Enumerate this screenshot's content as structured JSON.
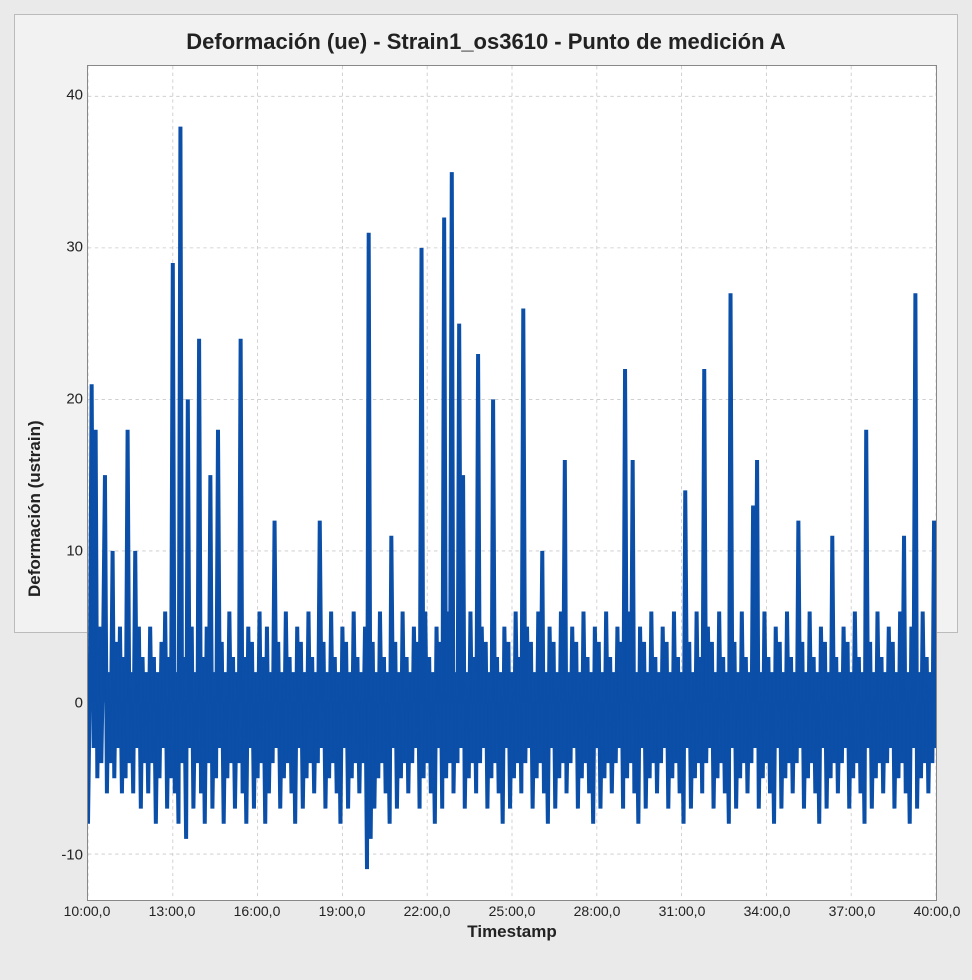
{
  "chart_data": {
    "type": "line",
    "title": "Deformación (ue) - Strain1_os3610 - Punto de medición A",
    "xlabel": "Timestamp",
    "ylabel": "Deformación (ustrain)",
    "ylim": [
      -13,
      42
    ],
    "xlim": [
      10,
      40
    ],
    "xticks": [
      "10:00,0",
      "13:00,0",
      "16:00,0",
      "19:00,0",
      "22:00,0",
      "25:00,0",
      "28:00,0",
      "31:00,0",
      "34:00,0",
      "37:00,0",
      "40:00,0"
    ],
    "yticks": [
      -10,
      0,
      10,
      20,
      30,
      40
    ],
    "color": "#0b4fa8",
    "note": "Dense noisy strain time-series; values approximate — read from pixel geometry",
    "series": [
      {
        "name": "Strain1_os3610",
        "x": [
          10.0,
          10.07,
          10.13,
          10.2,
          10.27,
          10.33,
          10.4,
          10.47,
          10.53,
          10.6,
          10.67,
          10.73,
          10.8,
          10.87,
          10.93,
          11.0,
          11.07,
          11.13,
          11.2,
          11.27,
          11.33,
          11.4,
          11.47,
          11.53,
          11.6,
          11.67,
          11.73,
          11.8,
          11.87,
          11.93,
          12.0,
          12.07,
          12.13,
          12.2,
          12.27,
          12.33,
          12.4,
          12.47,
          12.53,
          12.6,
          12.67,
          12.73,
          12.8,
          12.87,
          12.93,
          13.0,
          13.07,
          13.13,
          13.2,
          13.27,
          13.33,
          13.4,
          13.47,
          13.53,
          13.6,
          13.67,
          13.73,
          13.8,
          13.87,
          13.93,
          14.0,
          14.07,
          14.13,
          14.2,
          14.27,
          14.33,
          14.4,
          14.47,
          14.53,
          14.6,
          14.67,
          14.73,
          14.8,
          14.87,
          14.93,
          15.0,
          15.07,
          15.13,
          15.2,
          15.27,
          15.33,
          15.4,
          15.47,
          15.53,
          15.6,
          15.67,
          15.73,
          15.8,
          15.87,
          15.93,
          16.0,
          16.07,
          16.13,
          16.2,
          16.27,
          16.33,
          16.4,
          16.47,
          16.53,
          16.6,
          16.67,
          16.73,
          16.8,
          16.87,
          16.93,
          17.0,
          17.07,
          17.13,
          17.2,
          17.27,
          17.33,
          17.4,
          17.47,
          17.53,
          17.6,
          17.67,
          17.73,
          17.8,
          17.87,
          17.93,
          18.0,
          18.07,
          18.13,
          18.2,
          18.27,
          18.33,
          18.4,
          18.47,
          18.53,
          18.6,
          18.67,
          18.73,
          18.8,
          18.87,
          18.93,
          19.0,
          19.07,
          19.13,
          19.2,
          19.27,
          19.33,
          19.4,
          19.47,
          19.53,
          19.6,
          19.67,
          19.73,
          19.8,
          19.87,
          19.93,
          20.0,
          20.07,
          20.13,
          20.2,
          20.27,
          20.33,
          20.4,
          20.47,
          20.53,
          20.6,
          20.67,
          20.73,
          20.8,
          20.87,
          20.93,
          21.0,
          21.07,
          21.13,
          21.2,
          21.27,
          21.33,
          21.4,
          21.47,
          21.53,
          21.6,
          21.67,
          21.73,
          21.8,
          21.87,
          21.93,
          22.0,
          22.07,
          22.13,
          22.2,
          22.27,
          22.33,
          22.4,
          22.47,
          22.53,
          22.6,
          22.67,
          22.73,
          22.8,
          22.87,
          22.93,
          23.0,
          23.07,
          23.13,
          23.2,
          23.27,
          23.33,
          23.4,
          23.47,
          23.53,
          23.6,
          23.67,
          23.73,
          23.8,
          23.87,
          23.93,
          24.0,
          24.07,
          24.13,
          24.2,
          24.27,
          24.33,
          24.4,
          24.47,
          24.53,
          24.6,
          24.67,
          24.73,
          24.8,
          24.87,
          24.93,
          25.0,
          25.07,
          25.13,
          25.2,
          25.27,
          25.33,
          25.4,
          25.47,
          25.53,
          25.6,
          25.67,
          25.73,
          25.8,
          25.87,
          25.93,
          26.0,
          26.07,
          26.13,
          26.2,
          26.27,
          26.33,
          26.4,
          26.47,
          26.53,
          26.6,
          26.67,
          26.73,
          26.8,
          26.87,
          26.93,
          27.0,
          27.07,
          27.13,
          27.2,
          27.27,
          27.33,
          27.4,
          27.47,
          27.53,
          27.6,
          27.67,
          27.73,
          27.8,
          27.87,
          27.93,
          28.0,
          28.07,
          28.13,
          28.2,
          28.27,
          28.33,
          28.4,
          28.47,
          28.53,
          28.6,
          28.67,
          28.73,
          28.8,
          28.87,
          28.93,
          29.0,
          29.07,
          29.13,
          29.2,
          29.27,
          29.33,
          29.4,
          29.47,
          29.53,
          29.6,
          29.67,
          29.73,
          29.8,
          29.87,
          29.93,
          30.0,
          30.07,
          30.13,
          30.2,
          30.27,
          30.33,
          30.4,
          30.47,
          30.53,
          30.6,
          30.67,
          30.73,
          30.8,
          30.87,
          30.93,
          31.0,
          31.07,
          31.13,
          31.2,
          31.27,
          31.33,
          31.4,
          31.47,
          31.53,
          31.6,
          31.67,
          31.73,
          31.8,
          31.87,
          31.93,
          32.0,
          32.07,
          32.13,
          32.2,
          32.27,
          32.33,
          32.4,
          32.47,
          32.53,
          32.6,
          32.67,
          32.73,
          32.8,
          32.87,
          32.93,
          33.0,
          33.07,
          33.13,
          33.2,
          33.27,
          33.33,
          33.4,
          33.47,
          33.53,
          33.6,
          33.67,
          33.73,
          33.8,
          33.87,
          33.93,
          34.0,
          34.07,
          34.13,
          34.2,
          34.27,
          34.33,
          34.4,
          34.47,
          34.53,
          34.6,
          34.67,
          34.73,
          34.8,
          34.87,
          34.93,
          35.0,
          35.07,
          35.13,
          35.2,
          35.27,
          35.33,
          35.4,
          35.47,
          35.53,
          35.6,
          35.67,
          35.73,
          35.8,
          35.87,
          35.93,
          36.0,
          36.07,
          36.13,
          36.2,
          36.27,
          36.33,
          36.4,
          36.47,
          36.53,
          36.6,
          36.67,
          36.73,
          36.8,
          36.87,
          36.93,
          37.0,
          37.07,
          37.13,
          37.2,
          37.27,
          37.33,
          37.4,
          37.47,
          37.53,
          37.6,
          37.67,
          37.73,
          37.8,
          37.87,
          37.93,
          38.0,
          38.07,
          38.13,
          38.2,
          38.27,
          38.33,
          38.4,
          38.47,
          38.53,
          38.6,
          38.67,
          38.73,
          38.8,
          38.87,
          38.93,
          39.0,
          39.07,
          39.13,
          39.2,
          39.27,
          39.33,
          39.4,
          39.47,
          39.53,
          39.6,
          39.67,
          39.73,
          39.8,
          39.87,
          39.93,
          40.0
        ],
        "y": [
          -8,
          2,
          21,
          -3,
          18,
          -5,
          5,
          -4,
          3,
          15,
          -6,
          2,
          -4,
          10,
          -5,
          4,
          -3,
          5,
          -6,
          3,
          -5,
          18,
          -4,
          2,
          -6,
          10,
          -3,
          5,
          -7,
          3,
          -4,
          2,
          -6,
          5,
          -4,
          3,
          -8,
          2,
          -5,
          4,
          -3,
          6,
          -7,
          3,
          -5,
          29,
          -6,
          2,
          -8,
          38,
          -4,
          3,
          -9,
          20,
          -3,
          5,
          -7,
          2,
          -4,
          24,
          -6,
          3,
          -8,
          5,
          -4,
          15,
          -7,
          2,
          -5,
          18,
          -3,
          4,
          -8,
          2,
          -5,
          6,
          -4,
          3,
          -7,
          2,
          -4,
          24,
          -6,
          3,
          -8,
          5,
          -3,
          4,
          -7,
          2,
          -5,
          6,
          -4,
          3,
          -8,
          5,
          -6,
          2,
          -4,
          12,
          -3,
          4,
          -7,
          2,
          -5,
          6,
          -4,
          3,
          -6,
          2,
          -8,
          5,
          -3,
          4,
          -7,
          2,
          -5,
          6,
          -4,
          3,
          -6,
          2,
          -4,
          12,
          -3,
          4,
          -7,
          2,
          -5,
          6,
          -4,
          3,
          -6,
          2,
          -8,
          5,
          -3,
          4,
          -7,
          2,
          -5,
          6,
          -4,
          3,
          -6,
          2,
          -4,
          5,
          -11,
          31,
          -9,
          4,
          -7,
          2,
          -5,
          6,
          -4,
          3,
          -6,
          2,
          -8,
          11,
          -3,
          4,
          -7,
          2,
          -5,
          6,
          -4,
          3,
          -6,
          2,
          -4,
          5,
          -3,
          4,
          -7,
          30,
          -5,
          6,
          -4,
          3,
          -6,
          2,
          -8,
          5,
          -3,
          4,
          -7,
          32,
          -5,
          6,
          -4,
          35,
          -6,
          2,
          -4,
          25,
          -3,
          15,
          -7,
          2,
          -5,
          6,
          -4,
          3,
          -6,
          23,
          -4,
          5,
          -3,
          4,
          -7,
          2,
          -5,
          20,
          -4,
          3,
          -6,
          2,
          -8,
          5,
          -3,
          4,
          -7,
          2,
          -5,
          6,
          -4,
          3,
          -6,
          26,
          -4,
          5,
          -3,
          4,
          -7,
          2,
          -5,
          6,
          -4,
          10,
          -6,
          2,
          -8,
          5,
          -3,
          4,
          -7,
          2,
          -5,
          6,
          -4,
          16,
          -6,
          2,
          -4,
          5,
          -3,
          4,
          -7,
          2,
          -5,
          6,
          -4,
          3,
          -6,
          2,
          -8,
          5,
          -3,
          4,
          -7,
          2,
          -5,
          6,
          -4,
          3,
          -6,
          2,
          -4,
          5,
          -3,
          4,
          -7,
          22,
          -5,
          6,
          -4,
          16,
          -6,
          2,
          -8,
          5,
          -3,
          4,
          -7,
          2,
          -5,
          6,
          -4,
          3,
          -6,
          2,
          -4,
          5,
          -3,
          4,
          -7,
          2,
          -5,
          6,
          -4,
          3,
          -6,
          2,
          -8,
          14,
          -3,
          4,
          -7,
          2,
          -5,
          6,
          -4,
          3,
          -6,
          22,
          -4,
          5,
          -3,
          4,
          -7,
          2,
          -5,
          6,
          -4,
          3,
          -6,
          2,
          -8,
          27,
          -3,
          4,
          -7,
          2,
          -5,
          6,
          -4,
          3,
          -6,
          2,
          -4,
          13,
          -3,
          16,
          -7,
          2,
          -5,
          6,
          -4,
          3,
          -6,
          2,
          -8,
          5,
          -3,
          4,
          -7,
          2,
          -5,
          6,
          -4,
          3,
          -6,
          2,
          -4,
          12,
          -3,
          4,
          -7,
          2,
          -5,
          6,
          -4,
          3,
          -6,
          2,
          -8,
          5,
          -3,
          4,
          -7,
          2,
          -5,
          11,
          -4,
          3,
          -6,
          2,
          -4,
          5,
          -3,
          4,
          -7,
          2,
          -5,
          6,
          -4,
          3,
          -6,
          2,
          -8,
          18,
          -3,
          4,
          -7,
          2,
          -5,
          6,
          -4,
          3,
          -6,
          2,
          -4,
          5,
          -3,
          4,
          -7,
          2,
          -5,
          6,
          -4,
          11,
          -6,
          2,
          -8,
          5,
          -3,
          27,
          -7,
          2,
          -5,
          6,
          -4,
          3,
          -6,
          2,
          -4,
          12,
          -3,
          4,
          -7,
          2,
          -5,
          6,
          -4,
          3,
          -6,
          2,
          -8,
          5,
          -3,
          15,
          -7,
          2,
          -5,
          6,
          -4,
          3,
          -6,
          2,
          -4,
          12,
          -3,
          4,
          -7,
          2,
          -5,
          6,
          -4,
          3,
          -6,
          2,
          -8,
          5,
          -3,
          4,
          -7,
          2,
          -5,
          10,
          -4,
          3,
          -6,
          2,
          -4,
          9
        ]
      }
    ]
  }
}
